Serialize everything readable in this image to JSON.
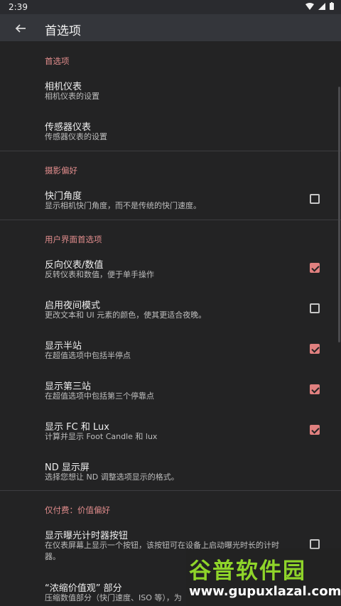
{
  "status_bar": {
    "time": "2:39"
  },
  "app_bar": {
    "title": "首选项"
  },
  "sections": [
    {
      "header": "首选项",
      "items": [
        {
          "title": "相机仪表",
          "summary": "相机仪表的设置"
        },
        {
          "title": "传感器仪表",
          "summary": "传感器仪表的设置"
        }
      ]
    },
    {
      "header": "摄影偏好",
      "items": [
        {
          "title": "快门角度",
          "summary": "显示相机快门角度，而不是传统的快门速度。",
          "checked": false
        }
      ]
    },
    {
      "header": "用户界面首选项",
      "items": [
        {
          "title": "反向仪表/数值",
          "summary": "反转仪表和数值，便于单手操作",
          "checked": true
        },
        {
          "title": "启用夜间模式",
          "summary": "更改文本和 UI 元素的颜色，使其更适合夜晚。",
          "checked": false
        },
        {
          "title": "显示半站",
          "summary": "在超值选项中包括半停点",
          "checked": true
        },
        {
          "title": "显示第三站",
          "summary": "在超值选项中包括第三个停靠点",
          "checked": true
        },
        {
          "title": "显示 FC 和 Lux",
          "summary": "计算并显示 Foot Candle 和 lux",
          "checked": true
        },
        {
          "title": "ND 显示屏",
          "summary": "选择您想让 ND 调整选项显示的格式。"
        }
      ]
    },
    {
      "header": "仅付费：价值偏好",
      "items": [
        {
          "title": "显示曝光计时器按钮",
          "summary_line1": "在仪表屏幕上显示一个按钮，该按钮可在设备上启动曝光时长的计时",
          "summary_line2": "器。",
          "checked": false
        },
        {
          "title": "“浓缩价值观” 部分",
          "summary": "压缩数值部分（快门速度、ISO 等），为"
        }
      ]
    }
  ],
  "watermark": {
    "brand": "谷普软件园",
    "url": "www.gupuxlazal.com"
  },
  "colors": {
    "accent": "#e0807f",
    "background": "#232324",
    "app_bar": "#34363b"
  }
}
